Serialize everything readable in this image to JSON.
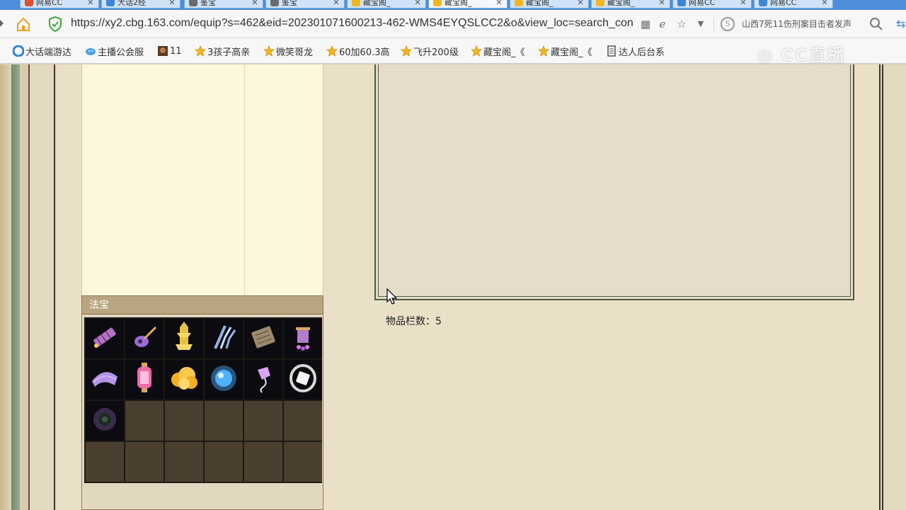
{
  "browser": {
    "tabs": [
      {
        "title": "网易CC",
        "icon_color": "#e0502a",
        "active": false
      },
      {
        "title": "大话2经",
        "icon_color": "#3c86d8",
        "active": false
      },
      {
        "title": "鉴宝",
        "icon_color": "#6b6b6b",
        "active": false
      },
      {
        "title": "鉴宝",
        "icon_color": "#6b6b6b",
        "active": false
      },
      {
        "title": "藏宝阁_",
        "icon_color": "#f1b71c",
        "active": false
      },
      {
        "title": "藏宝阁_",
        "icon_color": "#f1b71c",
        "active": true
      },
      {
        "title": "藏宝阁_",
        "icon_color": "#f1b71c",
        "active": false
      },
      {
        "title": "藏宝阁_",
        "icon_color": "#f1b71c",
        "active": false
      },
      {
        "title": "网易CC",
        "icon_color": "#3c86d8",
        "active": false
      },
      {
        "title": "网易CC",
        "icon_color": "#3c86d8",
        "active": false
      }
    ],
    "url": "https://xy2.cbg.163.com/equip?s=462&eid=202301071600213-462-WMS4EYQSLCC2&o&view_loc=search_con",
    "news_text": "山西7死11伤刑案目击者发声",
    "bookmarks": [
      {
        "label": "大话端游达",
        "icon": "cc-logo-icon"
      },
      {
        "label": "主播公会服",
        "icon": "cloud-logo-icon"
      },
      {
        "label": "11",
        "icon": "game-avatar-icon"
      },
      {
        "label": "3孩子高亲",
        "icon": "star-bookmark-icon"
      },
      {
        "label": "微笑哥龙",
        "icon": "star-bookmark-icon"
      },
      {
        "label": "60加60.3高",
        "icon": "star-bookmark-icon"
      },
      {
        "label": "飞升200级",
        "icon": "star-bookmark-icon"
      },
      {
        "label": "藏宝阁_《",
        "icon": "star-bookmark-icon"
      },
      {
        "label": "藏宝阁_《",
        "icon": "star-bookmark-icon"
      },
      {
        "label": "达人后台系",
        "icon": "document-icon"
      }
    ],
    "watermark": "CC直播"
  },
  "fabao_panel": {
    "title": "法宝",
    "items": [
      {
        "icon": "bamboo-scroll-icon",
        "color": "#c77dd8"
      },
      {
        "icon": "pipa-instrument-icon",
        "color": "#9a6bd6"
      },
      {
        "icon": "golden-pagoda-icon",
        "color": "#e8c242"
      },
      {
        "icon": "ice-claw-icon",
        "color": "#8fb6e8"
      },
      {
        "icon": "bronze-tablet-icon",
        "color": "#9b8a6d"
      },
      {
        "icon": "purple-lantern-icon",
        "color": "#c58ae0"
      },
      {
        "icon": "silk-fan-icon",
        "color": "#b394e8"
      },
      {
        "icon": "pink-lantern-icon",
        "color": "#f06aa8"
      },
      {
        "icon": "golden-cloud-icon",
        "color": "#f0b020"
      },
      {
        "icon": "blue-orb-icon",
        "color": "#4fb2ff"
      },
      {
        "icon": "jade-pendant-icon",
        "color": "#d9a6f0"
      },
      {
        "icon": "mirror-ring-icon",
        "color": "#d8d8d8"
      },
      {
        "icon": "dark-orb-icon",
        "color": "#6a4d8a"
      }
    ],
    "total_slots": 24
  },
  "detail": {
    "slot_count_label": "物品栏数：5"
  }
}
